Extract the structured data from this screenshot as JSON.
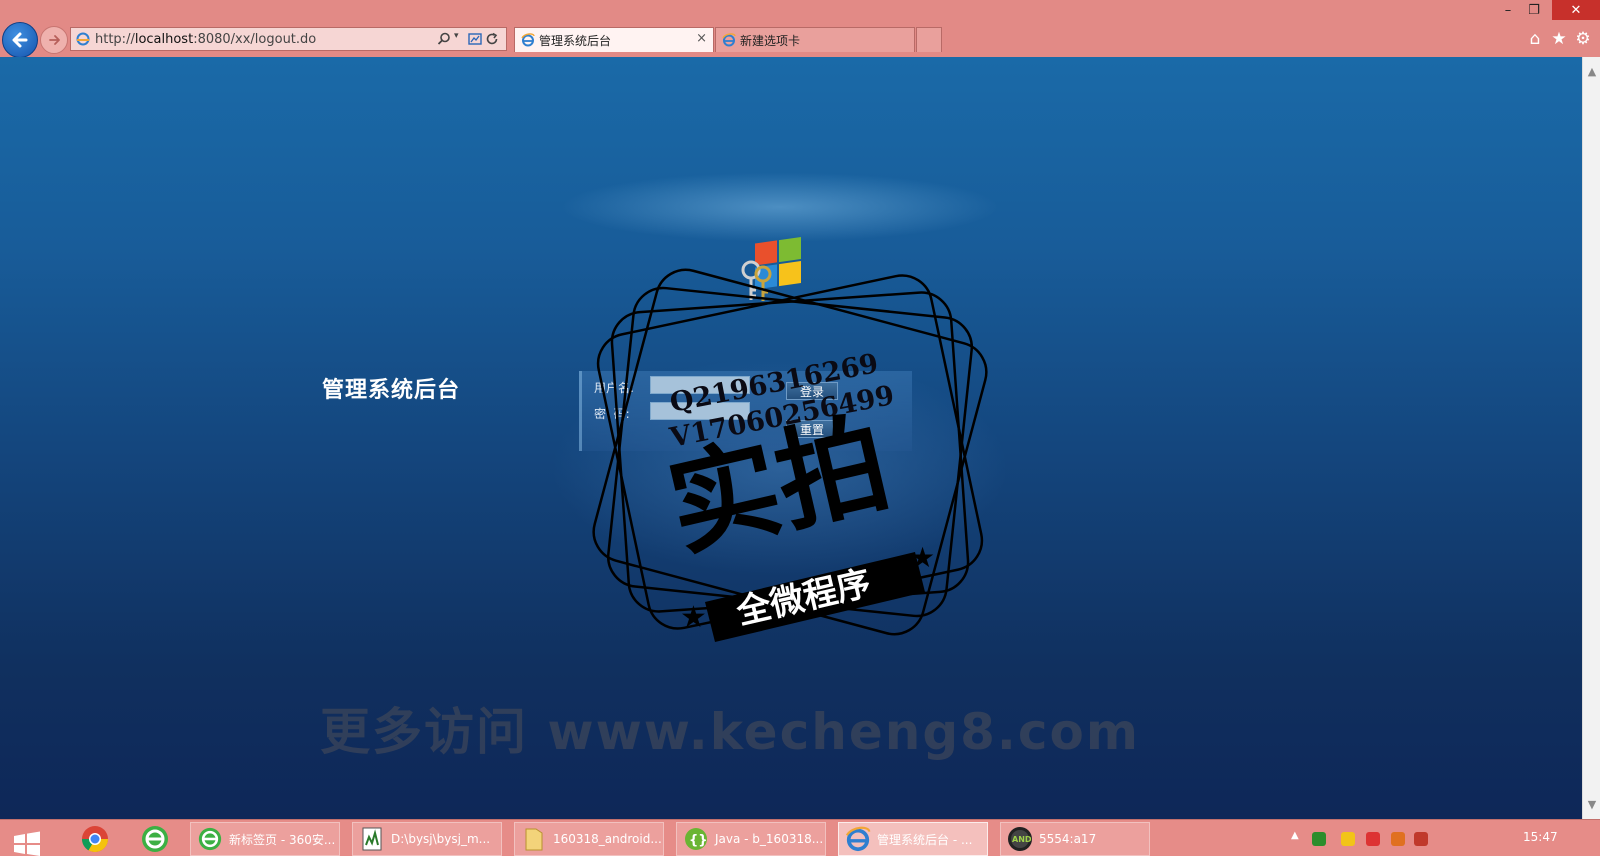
{
  "browser": {
    "url": "http://localhost:8080/xx/logout.do",
    "url_prefix": "http://",
    "url_host": "localhost",
    "url_path": ":8080/xx/logout.do",
    "tabs": [
      {
        "label": "管理系统后台",
        "active": true
      },
      {
        "label": "新建选项卡",
        "active": false
      }
    ],
    "tab_close": "×",
    "icons": [
      "back-icon",
      "forward-icon",
      "search-icon",
      "refresh-icon",
      "home-icon",
      "favorites-star-icon",
      "settings-gear-icon"
    ]
  },
  "page": {
    "title": "管理系统后台",
    "login": {
      "username_label": "用户名:",
      "password_label": "密  码:",
      "login_button": "登录",
      "reset_button": "重置"
    }
  },
  "watermark": {
    "qq": "Q2196316269",
    "phone": "V17060256499",
    "stamp_main": "实拍",
    "stamp_banner": "全微程序",
    "site": "更多访问 www.kecheng8.com"
  },
  "taskbar": {
    "items": [
      {
        "label": "新标签页 - 360安...",
        "icon": "360-browser-icon"
      },
      {
        "label": "D:\\bysj\\bysj_m...",
        "icon": "editor-icon"
      },
      {
        "label": "160318_android...",
        "icon": "folder-icon"
      },
      {
        "label": "Java - b_160318...",
        "icon": "eclipse-icon"
      },
      {
        "label": "管理系统后台 - ...",
        "icon": "ie-icon",
        "active": true
      },
      {
        "label": "5554:a17",
        "icon": "android-emulator-icon"
      }
    ],
    "clock": "15:47"
  },
  "colors": {
    "chrome": "#e28a86",
    "page_top": "#1a6aa8",
    "page_bottom": "#0e2758"
  }
}
